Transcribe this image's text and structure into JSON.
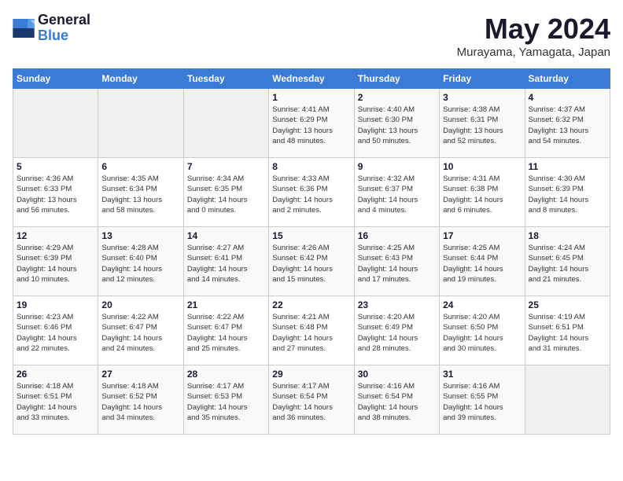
{
  "header": {
    "logo_line1": "General",
    "logo_line2": "Blue",
    "month": "May 2024",
    "location": "Murayama, Yamagata, Japan"
  },
  "weekdays": [
    "Sunday",
    "Monday",
    "Tuesday",
    "Wednesday",
    "Thursday",
    "Friday",
    "Saturday"
  ],
  "weeks": [
    [
      {
        "day": "",
        "content": ""
      },
      {
        "day": "",
        "content": ""
      },
      {
        "day": "",
        "content": ""
      },
      {
        "day": "1",
        "content": "Sunrise: 4:41 AM\nSunset: 6:29 PM\nDaylight: 13 hours\nand 48 minutes."
      },
      {
        "day": "2",
        "content": "Sunrise: 4:40 AM\nSunset: 6:30 PM\nDaylight: 13 hours\nand 50 minutes."
      },
      {
        "day": "3",
        "content": "Sunrise: 4:38 AM\nSunset: 6:31 PM\nDaylight: 13 hours\nand 52 minutes."
      },
      {
        "day": "4",
        "content": "Sunrise: 4:37 AM\nSunset: 6:32 PM\nDaylight: 13 hours\nand 54 minutes."
      }
    ],
    [
      {
        "day": "5",
        "content": "Sunrise: 4:36 AM\nSunset: 6:33 PM\nDaylight: 13 hours\nand 56 minutes."
      },
      {
        "day": "6",
        "content": "Sunrise: 4:35 AM\nSunset: 6:34 PM\nDaylight: 13 hours\nand 58 minutes."
      },
      {
        "day": "7",
        "content": "Sunrise: 4:34 AM\nSunset: 6:35 PM\nDaylight: 14 hours\nand 0 minutes."
      },
      {
        "day": "8",
        "content": "Sunrise: 4:33 AM\nSunset: 6:36 PM\nDaylight: 14 hours\nand 2 minutes."
      },
      {
        "day": "9",
        "content": "Sunrise: 4:32 AM\nSunset: 6:37 PM\nDaylight: 14 hours\nand 4 minutes."
      },
      {
        "day": "10",
        "content": "Sunrise: 4:31 AM\nSunset: 6:38 PM\nDaylight: 14 hours\nand 6 minutes."
      },
      {
        "day": "11",
        "content": "Sunrise: 4:30 AM\nSunset: 6:39 PM\nDaylight: 14 hours\nand 8 minutes."
      }
    ],
    [
      {
        "day": "12",
        "content": "Sunrise: 4:29 AM\nSunset: 6:39 PM\nDaylight: 14 hours\nand 10 minutes."
      },
      {
        "day": "13",
        "content": "Sunrise: 4:28 AM\nSunset: 6:40 PM\nDaylight: 14 hours\nand 12 minutes."
      },
      {
        "day": "14",
        "content": "Sunrise: 4:27 AM\nSunset: 6:41 PM\nDaylight: 14 hours\nand 14 minutes."
      },
      {
        "day": "15",
        "content": "Sunrise: 4:26 AM\nSunset: 6:42 PM\nDaylight: 14 hours\nand 15 minutes."
      },
      {
        "day": "16",
        "content": "Sunrise: 4:25 AM\nSunset: 6:43 PM\nDaylight: 14 hours\nand 17 minutes."
      },
      {
        "day": "17",
        "content": "Sunrise: 4:25 AM\nSunset: 6:44 PM\nDaylight: 14 hours\nand 19 minutes."
      },
      {
        "day": "18",
        "content": "Sunrise: 4:24 AM\nSunset: 6:45 PM\nDaylight: 14 hours\nand 21 minutes."
      }
    ],
    [
      {
        "day": "19",
        "content": "Sunrise: 4:23 AM\nSunset: 6:46 PM\nDaylight: 14 hours\nand 22 minutes."
      },
      {
        "day": "20",
        "content": "Sunrise: 4:22 AM\nSunset: 6:47 PM\nDaylight: 14 hours\nand 24 minutes."
      },
      {
        "day": "21",
        "content": "Sunrise: 4:22 AM\nSunset: 6:47 PM\nDaylight: 14 hours\nand 25 minutes."
      },
      {
        "day": "22",
        "content": "Sunrise: 4:21 AM\nSunset: 6:48 PM\nDaylight: 14 hours\nand 27 minutes."
      },
      {
        "day": "23",
        "content": "Sunrise: 4:20 AM\nSunset: 6:49 PM\nDaylight: 14 hours\nand 28 minutes."
      },
      {
        "day": "24",
        "content": "Sunrise: 4:20 AM\nSunset: 6:50 PM\nDaylight: 14 hours\nand 30 minutes."
      },
      {
        "day": "25",
        "content": "Sunrise: 4:19 AM\nSunset: 6:51 PM\nDaylight: 14 hours\nand 31 minutes."
      }
    ],
    [
      {
        "day": "26",
        "content": "Sunrise: 4:18 AM\nSunset: 6:51 PM\nDaylight: 14 hours\nand 33 minutes."
      },
      {
        "day": "27",
        "content": "Sunrise: 4:18 AM\nSunset: 6:52 PM\nDaylight: 14 hours\nand 34 minutes."
      },
      {
        "day": "28",
        "content": "Sunrise: 4:17 AM\nSunset: 6:53 PM\nDaylight: 14 hours\nand 35 minutes."
      },
      {
        "day": "29",
        "content": "Sunrise: 4:17 AM\nSunset: 6:54 PM\nDaylight: 14 hours\nand 36 minutes."
      },
      {
        "day": "30",
        "content": "Sunrise: 4:16 AM\nSunset: 6:54 PM\nDaylight: 14 hours\nand 38 minutes."
      },
      {
        "day": "31",
        "content": "Sunrise: 4:16 AM\nSunset: 6:55 PM\nDaylight: 14 hours\nand 39 minutes."
      },
      {
        "day": "",
        "content": ""
      }
    ]
  ]
}
